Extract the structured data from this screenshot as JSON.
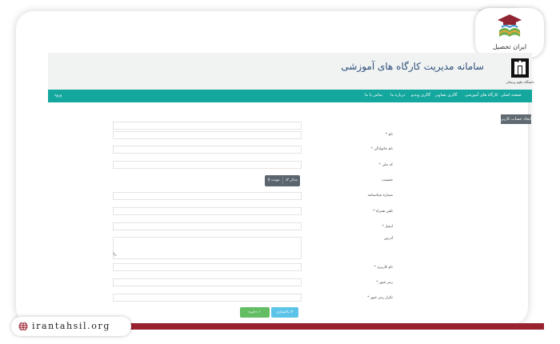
{
  "badge": {
    "brand_name": "ایران تحصیل"
  },
  "footer": {
    "domain": "irantahsil.org"
  },
  "site": {
    "title": "سامانه مدیریت کارگاه های آموزشی",
    "logo_caption": "دانشگاه علوم پزشکی"
  },
  "nav": {
    "items": [
      "صفحه اصلی",
      "کارگاه های آموزشی",
      "گالری تصاویر",
      "گالری ویدیو",
      "درباره ما",
      "تماس با ما"
    ],
    "login": "ورود"
  },
  "form": {
    "section_title": "ایجاد حساب کاربری",
    "fields": {
      "first_name": "نام *",
      "last_name": "نام خانوادگی *",
      "national_code": "کد ملی *",
      "gender": "جنسیت",
      "id_number": "شماره شناسنامه",
      "mobile": "تلفن همراه *",
      "email": "ایمیل *",
      "address": "آدرس",
      "username": "نام کاربری *",
      "password": "رمز عبور *",
      "password_repeat": "تکرار رمز عبور *"
    },
    "gender_options": {
      "male": "مذکر",
      "female": "مونث"
    },
    "buttons": {
      "save": "ذخیره",
      "reset": "پاکسازی"
    }
  }
}
